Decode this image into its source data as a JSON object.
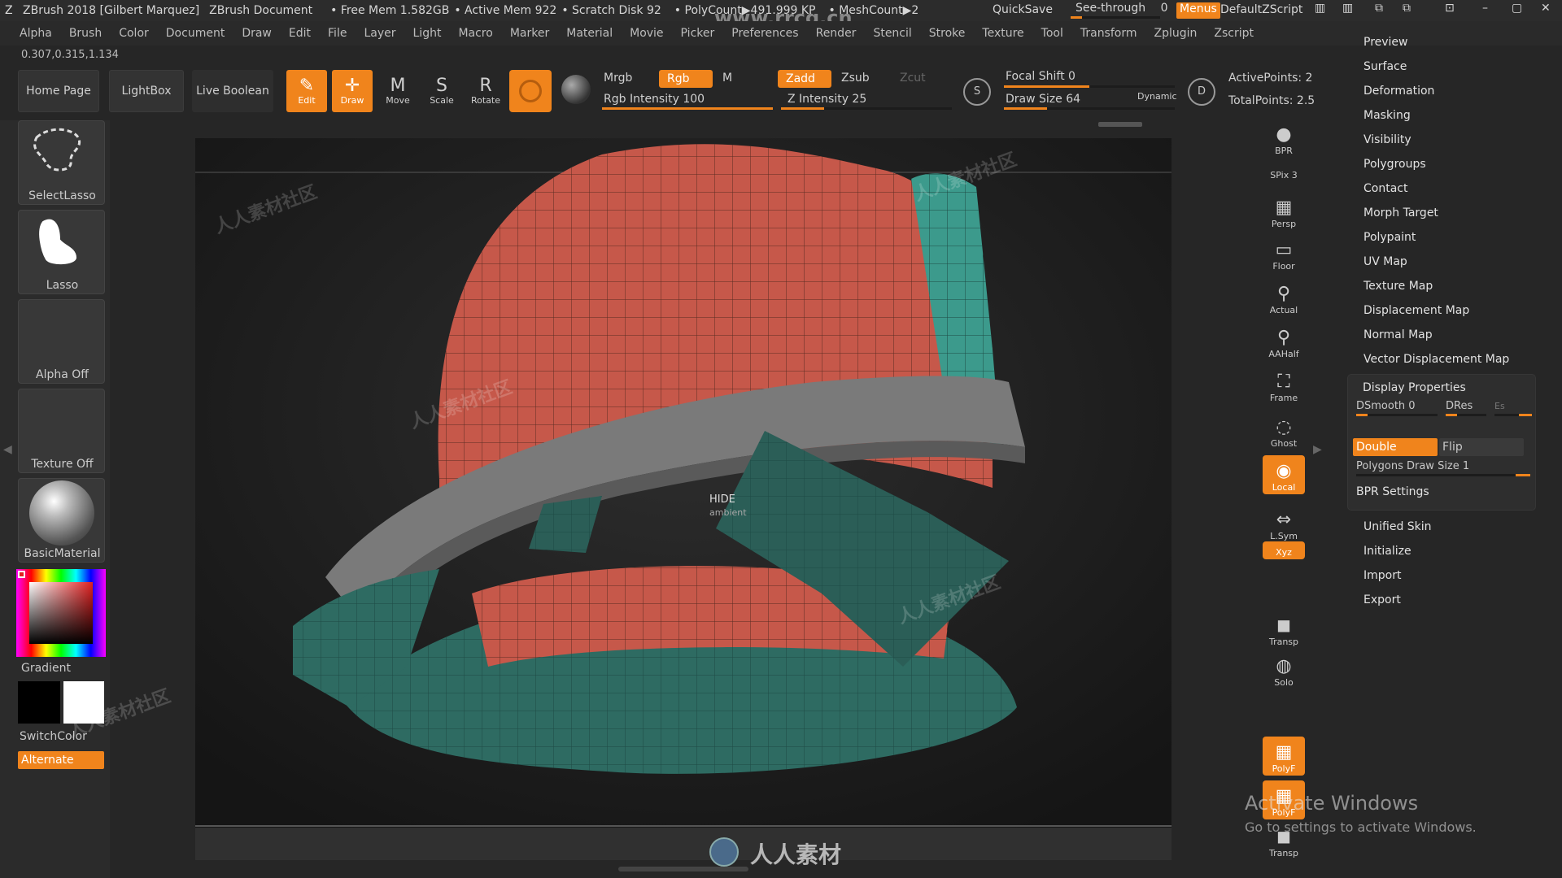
{
  "titlebar": {
    "app": "ZBrush 2018 [Gilbert Marquez]",
    "document": "ZBrush Document",
    "free_mem": "• Free Mem 1.582GB",
    "active_mem": "• Active Mem 922",
    "scratch": "• Scratch Disk 92",
    "polycount": "• PolyCount▶491.999 KP",
    "meshcount": "• MeshCount▶2",
    "quicksave": "QuickSave",
    "seethrough": "See-through",
    "seethrough_value": "0",
    "menus": "Menus",
    "zscript": "DefaultZScript",
    "watermark_url": "www.rrcg.cn"
  },
  "menubar": [
    "Alpha",
    "Brush",
    "Color",
    "Document",
    "Draw",
    "Edit",
    "File",
    "Layer",
    "Light",
    "Macro",
    "Marker",
    "Material",
    "Movie",
    "Picker",
    "Preferences",
    "Render",
    "Stencil",
    "Stroke",
    "Texture",
    "Tool",
    "Transform",
    "Zplugin",
    "Zscript"
  ],
  "coords": "0.307,0.315,1.134",
  "shelf": {
    "home": "Home Page",
    "lightbox": "LightBox",
    "live_boolean": "Live Boolean",
    "tools": [
      {
        "label": "Edit",
        "icon": "✎",
        "active": true
      },
      {
        "label": "Draw",
        "icon": "✛",
        "active": true
      },
      {
        "label": "Move",
        "icon": "M",
        "active": false
      },
      {
        "label": "Scale",
        "icon": "S",
        "active": false
      },
      {
        "label": "Rotate",
        "icon": "R",
        "active": false
      }
    ],
    "mrgb": "Mrgb",
    "rgb": "Rgb",
    "m": "M",
    "rgb_intensity": "Rgb Intensity 100",
    "zadd": "Zadd",
    "zsub": "Zsub",
    "zcut": "Zcut",
    "z_intensity": "Z Intensity 25",
    "focal_shift": "Focal Shift 0",
    "draw_size": "Draw Size 64",
    "dynamic": "Dynamic",
    "active_points": "ActivePoints: 2",
    "total_points": "TotalPoints: 2.5"
  },
  "left": {
    "tiles": [
      "SelectLasso",
      "Lasso",
      "Alpha Off",
      "Texture Off",
      "BasicMaterial"
    ],
    "gradient": "Gradient",
    "switchcolor": "SwitchColor",
    "alternate": "Alternate"
  },
  "viewport": {
    "hide_label": "HIDE",
    "hide_sub": "ambient"
  },
  "rightshelf": [
    {
      "label": "BPR",
      "icon": "●"
    },
    {
      "label": "SPix 3",
      "icon": ""
    },
    {
      "label": "Persp",
      "icon": "▦"
    },
    {
      "label": "Floor",
      "icon": "▭"
    },
    {
      "label": "Actual",
      "icon": "⚲"
    },
    {
      "label": "AAHalf",
      "icon": "⚲"
    },
    {
      "label": "Frame",
      "icon": "⛶"
    },
    {
      "label": "Ghost",
      "icon": "◌"
    },
    {
      "label": "Local",
      "icon": "◉"
    },
    {
      "label": "L.Sym",
      "icon": "⇔"
    },
    {
      "label": "Xyz",
      "icon": ""
    },
    {
      "label": "Transp",
      "icon": "◼"
    },
    {
      "label": "Solo",
      "icon": "◍"
    },
    {
      "label": "PolyF",
      "icon": "▦"
    },
    {
      "label": "PolyF",
      "icon": "▦"
    },
    {
      "label": "Transp",
      "icon": "◼"
    }
  ],
  "rightmenu": {
    "items": [
      "Preview",
      "Surface",
      "Deformation",
      "Masking",
      "Visibility",
      "Polygroups",
      "Contact",
      "Morph Target",
      "Polypaint",
      "UV Map",
      "Texture Map",
      "Displacement Map",
      "Normal Map",
      "Vector Displacement Map"
    ],
    "display_properties": "Display Properties",
    "dsmooth": "DSmooth 0",
    "dres": "DRes",
    "es": "Es",
    "double": "Double",
    "flip": "Flip",
    "poly_draw_size": "Polygons Draw Size 1",
    "bpr_settings": "BPR Settings",
    "bottom_items": [
      "Unified Skin",
      "Initialize",
      "Import",
      "Export"
    ]
  },
  "activate": {
    "title": "Activate Windows",
    "sub": "Go to settings to activate Windows."
  },
  "logo_text": "人人素材"
}
